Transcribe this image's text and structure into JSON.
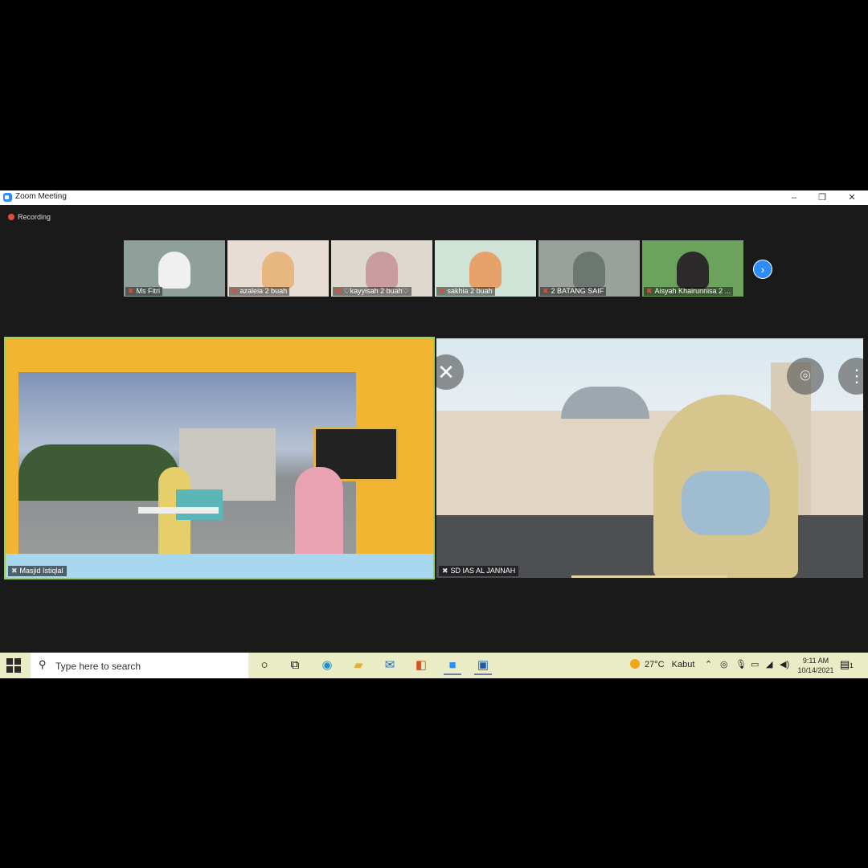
{
  "window": {
    "title": "Zoom Meeting",
    "minimize_glyph": "–",
    "maximize_glyph": "❐",
    "close_glyph": "✕"
  },
  "recording": {
    "label": "Recording",
    "color": "#e04b3a"
  },
  "participants": [
    {
      "name": "Ms Fitri",
      "bg": "#8fa09a",
      "face": "#f0f0f0"
    },
    {
      "name": "azaleia  2 buah",
      "bg": "#e8ddd4",
      "face": "#e6b77e"
    },
    {
      "name": "♡kayyisah 2 buah♡",
      "bg": "#ded8cf",
      "face": "#c99ca0"
    },
    {
      "name": "sakhia 2 buah",
      "bg": "#cfe3d6",
      "face": "#e7a26b"
    },
    {
      "name": "2 BATANG SAIF",
      "bg": "#9aa19a",
      "face": "#6d7772"
    },
    {
      "name": "Aisyah Khairunnisa 2 ...",
      "bg": "#6ba35c",
      "face": "#2c2a2a"
    }
  ],
  "next_page_glyph": "›",
  "tiles": [
    {
      "name": "Masjid Istiqlal",
      "active_border": "#9ad04a"
    },
    {
      "name": "SD IAS AL JANNAH"
    }
  ],
  "taskbar": {
    "search_placeholder": "Type here to search",
    "weather_temp": "27°C",
    "weather_text": "Kabut",
    "time": "9:11 AM",
    "date": "10/14/2021",
    "notification_count": "1"
  },
  "icons": [
    "windows-start-icon",
    "search-icon",
    "cortana-icon",
    "task-view-icon",
    "edge-icon",
    "file-explorer-icon",
    "mail-icon",
    "office-icon",
    "zoom-icon",
    "word-icon",
    "weather-icon",
    "chevron-up-icon",
    "wifi-icon",
    "mic-icon",
    "battery-icon",
    "network-icon",
    "volume-icon",
    "notification-icon"
  ]
}
